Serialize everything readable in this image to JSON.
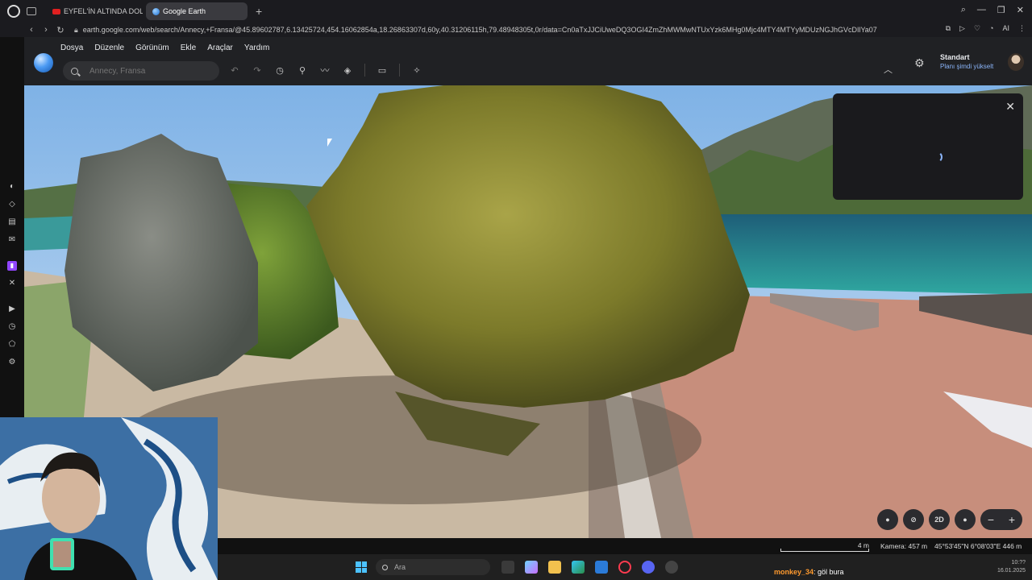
{
  "browser": {
    "tabs": [
      {
        "label": "EYFEL'İN ALTINDA DOLAN",
        "icon": "youtube-icon"
      },
      {
        "label": "Google Earth",
        "icon": "google-earth-icon",
        "active": true
      }
    ],
    "new_tab": "+",
    "url": "earth.google.com/web/search/Annecy,+Fransa/@45.89602787,6.13425724,454.16062854a,18.26863307d,60y,40.31206115h,79.48948305t,0r/data=Cn0aTxJJCiUweDQ3OGI4ZmZhMWMwNTUxYzk6MHg0Mjc4MTY4MTYyMDUzNGJhGVcDIlYa07",
    "ai_label": "AI"
  },
  "earth": {
    "menu": [
      "Dosya",
      "Düzenle",
      "Görünüm",
      "Ekle",
      "Araçlar",
      "Yardım"
    ],
    "search_placeholder": "Annecy, Fransa",
    "plan": {
      "name": "Standart",
      "upgrade": "Planı şimdi yükselt"
    },
    "view_mode": "2D",
    "zoom_out": "−",
    "zoom_in": "+"
  },
  "status": {
    "scale": "4 m",
    "camera": "Kamera: 457 m",
    "coords": "45°53'45\"N 6°08'03\"E  446 m"
  },
  "taskbar": {
    "search_placeholder": "Ara",
    "chat_user": "monkey_34",
    "chat_message": ": göl bura",
    "clock_time": "10:??",
    "clock_date": "16.01.2025"
  }
}
